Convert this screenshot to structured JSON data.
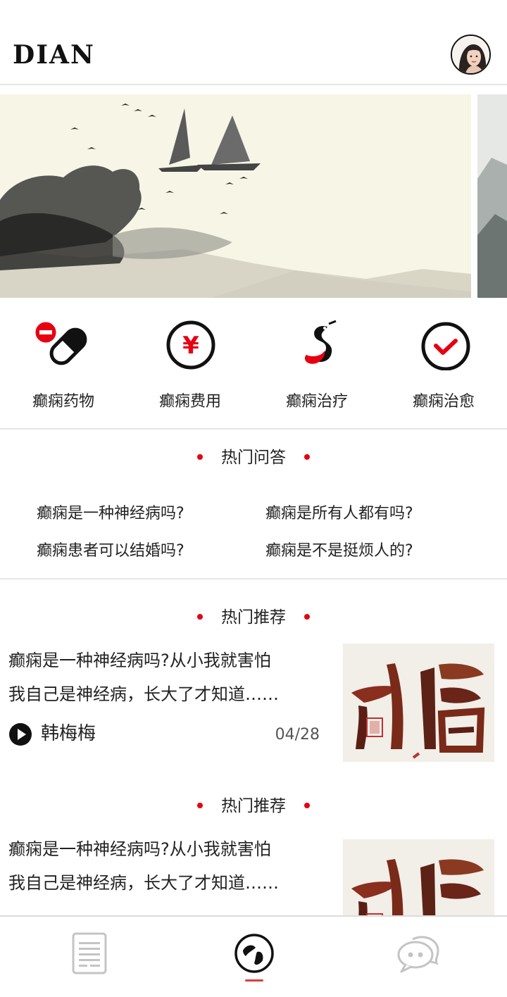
{
  "header": {
    "logo": "DIAN"
  },
  "categories": [
    {
      "label": "癫痫药物",
      "icon": "pill-icon"
    },
    {
      "label": "癫痫费用",
      "icon": "yuan-icon"
    },
    {
      "label": "癫痫治疗",
      "icon": "snake-icon"
    },
    {
      "label": "癫痫治愈",
      "icon": "check-circle-icon"
    }
  ],
  "qa": {
    "title": "热门问答",
    "items": [
      "癫痫是一种神经病吗?",
      "癫痫是所有人都有吗?",
      "癫痫患者可以结婚吗?",
      "癫痫是不是挺烦人的?"
    ]
  },
  "recommend": [
    {
      "title": "热门推荐",
      "line1": "癫痫是一种神经病吗?从小我就害怕",
      "line2": "我自己是神经病，长大了才知道……",
      "author": "韩梅梅",
      "date": "04/28"
    },
    {
      "title": "热门推荐",
      "line1": "癫痫是一种神经病吗?从小我就害怕",
      "line2": "我自己是神经病，长大了才知道……"
    }
  ],
  "tabs": [
    {
      "icon": "list-icon",
      "active": false
    },
    {
      "icon": "globe-icon",
      "active": true
    },
    {
      "icon": "chat-icon",
      "active": false
    }
  ],
  "colors": {
    "accent": "#e60012",
    "indicator": "#e63a3a",
    "divider": "#e6e6e6"
  }
}
